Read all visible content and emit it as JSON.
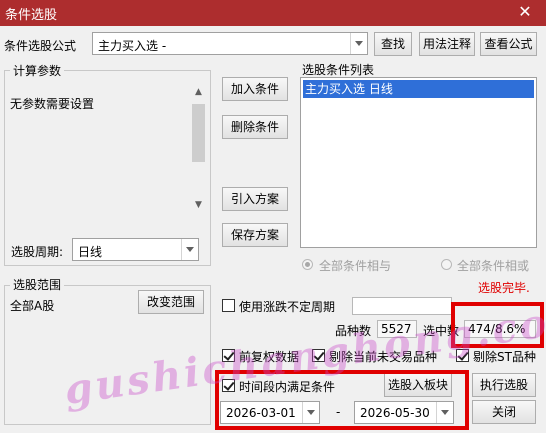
{
  "window": {
    "title": "条件选股",
    "close": "✕"
  },
  "top": {
    "formula_label": "条件选股公式",
    "formula_value": "主力买入选  -",
    "find": "查找",
    "usage": "用法注释",
    "view_formula": "查看公式"
  },
  "params": {
    "group_title": "计算参数",
    "no_params": "无参数需要设置",
    "period_label": "选股周期:",
    "period_value": "日线"
  },
  "middle_buttons": {
    "add": "加入条件",
    "delete": "删除条件",
    "import": "引入方案",
    "save": "保存方案"
  },
  "conditions": {
    "title": "选股条件列表",
    "items": [
      "主力买入选  日线"
    ],
    "all_and": "全部条件相与",
    "all_or": "全部条件相或"
  },
  "range": {
    "group_title": "选股范围",
    "value": "全部A股",
    "change": "改变范围"
  },
  "status": {
    "done": "选股完毕."
  },
  "options": {
    "use_variable_period": "使用涨跌不定周期",
    "count_label": "品种数",
    "count": "5527",
    "selected_label": "选中数",
    "selected": "474/8.6%",
    "pre_adjust": "前复权数据",
    "exclude_untraded": "剔除当前未交易品种",
    "exclude_st": "剔除ST品种",
    "time_range": "时间段内满足条件",
    "to_block": "选股入板块",
    "execute": "执行选股",
    "date_start": "2026-03-01",
    "date_sep": "-",
    "date_end": "2026-05-30",
    "close": "关闭"
  },
  "watermark": "gushichanghong.com",
  "colors": {
    "title_bar": "#ad2d2e",
    "selection": "#2f6fd8",
    "status_red": "#e00000",
    "highlight_box": "#e00000"
  }
}
